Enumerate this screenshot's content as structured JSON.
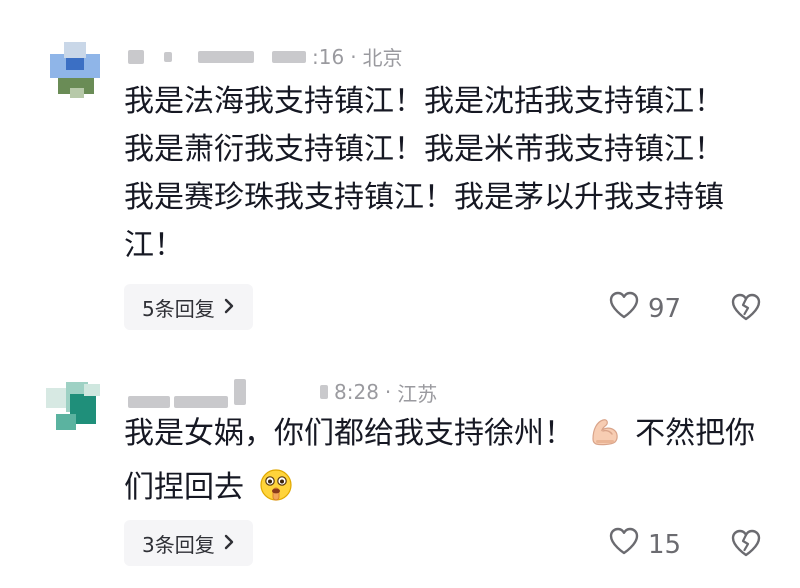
{
  "comments": [
    {
      "time": ":16",
      "location": "北京",
      "lines": [
        "我是法海我支持镇江！我是沈括我支持镇江！",
        "我是萧衍我支持镇江！我是米芾我支持镇江！",
        "我是赛珍珠我支持镇江！我是茅以升我支持镇",
        "江！"
      ],
      "replies_label": "5条回复",
      "likes": "97",
      "avatar_colors": [
        "#3b6fc4",
        "#8fb5e8",
        "#6a8c56",
        "#c9d7e8"
      ]
    },
    {
      "time": "8:28",
      "location": "江苏",
      "line1_before_emoji": "我是女娲，你们都给我支持徐州！",
      "line1_after_emoji": "不然把你",
      "line2": "们捏回去",
      "replies_label": "3条回复",
      "likes": "15",
      "avatar_colors": [
        "#1f8f7a",
        "#9ed1c4",
        "#d7e9e3",
        "#5bb3a0"
      ]
    }
  ],
  "icons": {
    "heart": "heart-icon",
    "broken_heart": "broken-heart-icon",
    "chevron": "chevron-right-icon",
    "muscle": "flexed-biceps-icon",
    "shush": "shushing-face-icon"
  }
}
